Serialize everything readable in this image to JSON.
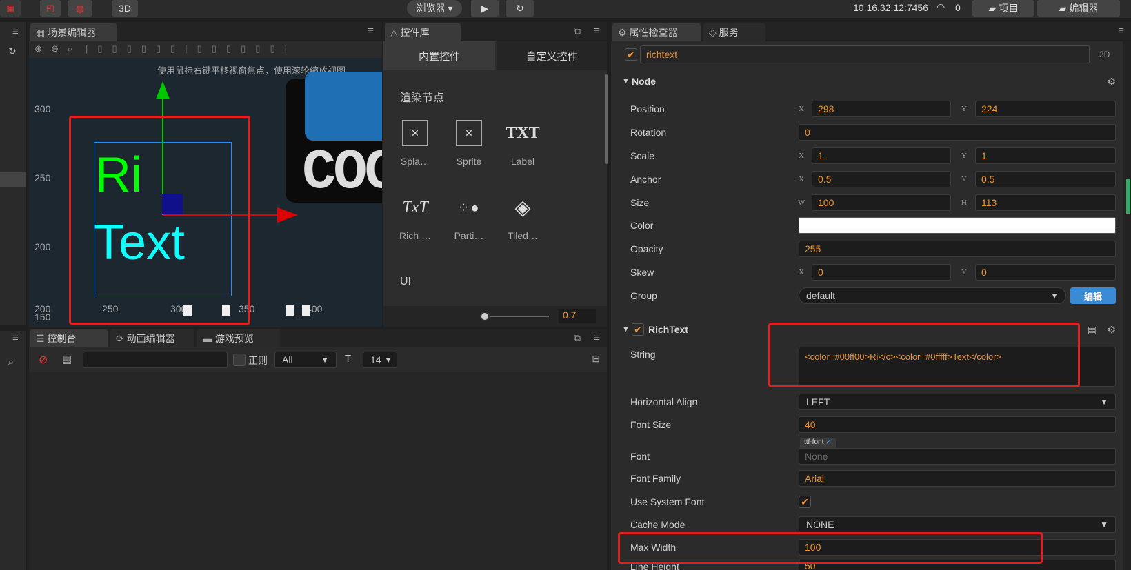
{
  "topbar": {
    "mode3d": "3D",
    "browser_label": "浏览器 ▾",
    "play_icon": "play-icon",
    "refresh_icon": "refresh-icon",
    "ip": "10.16.32.12:7456",
    "wifi_count": "0",
    "project_label": "项目",
    "editor_label": "编辑器"
  },
  "scene": {
    "tab": "场景编辑器",
    "hint": "使用鼠标右键平移视窗焦点，使用滚轮缩放视图",
    "y_ticks": [
      "300",
      "250",
      "200",
      "150"
    ],
    "x_ticks": [
      "200",
      "250",
      "300",
      "350",
      "400"
    ],
    "text_ri": "Ri",
    "text_text": "Text",
    "logo_text": "COC"
  },
  "library": {
    "tab": "控件库",
    "tab_builtin": "内置控件",
    "tab_custom": "自定义控件",
    "section_render": "渲染节点",
    "section_ui": "UI",
    "items": [
      {
        "label": "Spla…",
        "icon": "splash-icon"
      },
      {
        "label": "Sprite",
        "icon": "sprite-icon"
      },
      {
        "label": "Label",
        "icon": "label-icon",
        "glyph": "TXT"
      },
      {
        "label": "Rich …",
        "icon": "richtext-icon",
        "glyph": "TxT"
      },
      {
        "label": "Parti…",
        "icon": "particle-icon"
      },
      {
        "label": "Tiled…",
        "icon": "tiled-icon"
      }
    ],
    "zoom_value": "0.7"
  },
  "console": {
    "tabs": [
      "控制台",
      "动画编辑器",
      "游戏预览"
    ],
    "regex_label": "正则",
    "filter_value": "All",
    "font_size": "14"
  },
  "inspector": {
    "tab": "属性检查器",
    "tab_service": "服务",
    "node_name": "richtext",
    "node_3d": "3D",
    "node_section": "Node",
    "position": {
      "label": "Position",
      "x": "298",
      "y": "224"
    },
    "rotation": {
      "label": "Rotation",
      "value": "0"
    },
    "scale": {
      "label": "Scale",
      "x": "1",
      "y": "1"
    },
    "anchor": {
      "label": "Anchor",
      "x": "0.5",
      "y": "0.5"
    },
    "size": {
      "label": "Size",
      "w": "100",
      "h": "113"
    },
    "color_label": "Color",
    "color_value": "#ffffff",
    "opacity": {
      "label": "Opacity",
      "value": "255"
    },
    "skew": {
      "label": "Skew",
      "x": "0",
      "y": "0"
    },
    "group": {
      "label": "Group",
      "value": "default",
      "edit": "编辑"
    },
    "axis_x": "X",
    "axis_y": "Y",
    "axis_w": "W",
    "axis_h": "H",
    "richtext_section": "RichText",
    "string": {
      "label": "String",
      "value": "<color=#00ff00>Ri</c><color=#0fffff>Text</color>"
    },
    "halign": {
      "label": "Horizontal Align",
      "value": "LEFT"
    },
    "font_size": {
      "label": "Font Size",
      "value": "40"
    },
    "font": {
      "label": "Font",
      "tag": "ttf-font",
      "value": "None"
    },
    "font_family": {
      "label": "Font Family",
      "value": "Arial"
    },
    "use_system_font": {
      "label": "Use System Font",
      "checked": true
    },
    "cache_mode": {
      "label": "Cache Mode",
      "value": "NONE"
    },
    "max_width": {
      "label": "Max Width",
      "value": "100"
    },
    "line_height": {
      "label": "Line Height",
      "value": "50"
    }
  },
  "colors": {
    "accent": "#f0922d",
    "highlight_red": "#e02020",
    "green": "#00ff00",
    "cyan": "#0fffff"
  }
}
